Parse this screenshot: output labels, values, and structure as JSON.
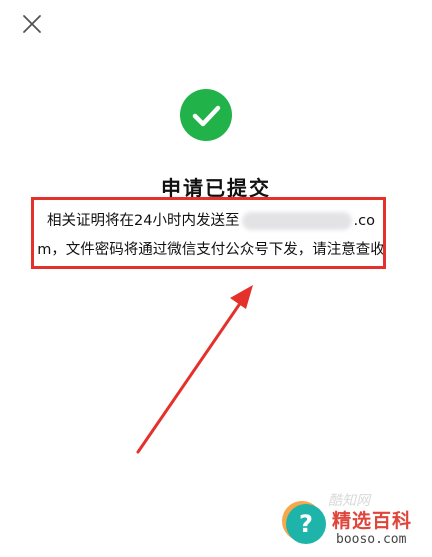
{
  "header": {
    "close_icon": "close-icon"
  },
  "status": {
    "icon": "check-circle-icon",
    "color": "#21b34a",
    "title": "申请已提交"
  },
  "message": {
    "before_email": "相关证明将在24小时内发送至",
    "email_suffix": ".com",
    "after_email": "，文件密码将通过微信支付公众号下发，请注意查收"
  },
  "annotation": {
    "highlight_color": "#e5312b"
  },
  "watermark": {
    "icon_glyph": "?",
    "brand": "精选百科",
    "domain": "booso.com",
    "faint_text": "酷知网"
  }
}
